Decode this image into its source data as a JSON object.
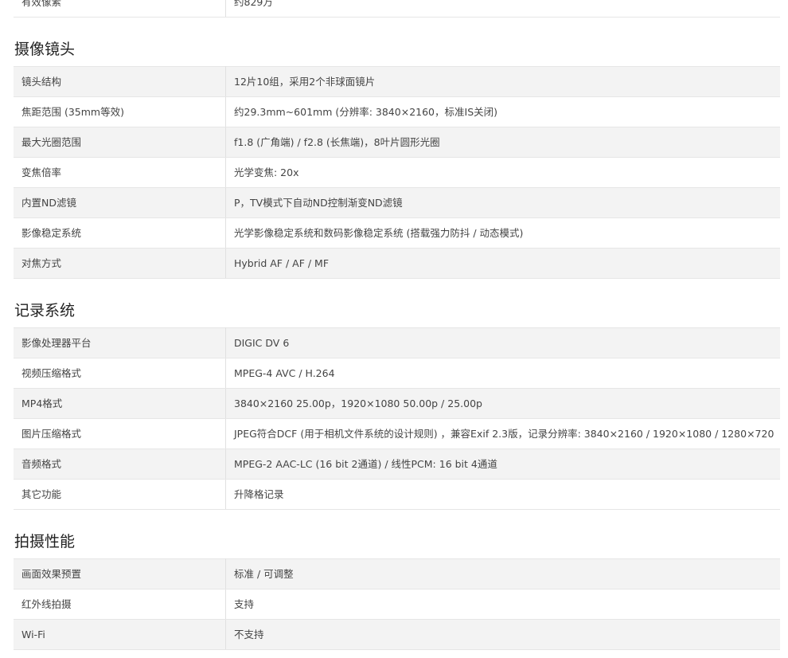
{
  "top_row": {
    "label": "有效像素",
    "value": "约829万"
  },
  "sections": [
    {
      "title": "摄像镜头",
      "rows": [
        {
          "label": "镜头结构",
          "value": "12片10组，采用2个非球面镜片"
        },
        {
          "label": "焦距范围 (35mm等效)",
          "value": "约29.3mm~601mm (分辨率: 3840×2160，标准IS关闭)"
        },
        {
          "label": "最大光圈范围",
          "value": "f1.8 (广角端) / f2.8 (长焦端)，8叶片圆形光圈"
        },
        {
          "label": "变焦倍率",
          "value": "光学变焦: 20x"
        },
        {
          "label": "内置ND滤镜",
          "value": "P，TV模式下自动ND控制渐变ND滤镜"
        },
        {
          "label": "影像稳定系统",
          "value": "光学影像稳定系统和数码影像稳定系统 (搭载强力防抖 / 动态模式)"
        },
        {
          "label": "对焦方式",
          "value": "Hybrid AF / AF / MF"
        }
      ]
    },
    {
      "title": "记录系统",
      "rows": [
        {
          "label": "影像处理器平台",
          "value": "DIGIC DV 6"
        },
        {
          "label": "视频压缩格式",
          "value": "MPEG-4 AVC / H.264"
        },
        {
          "label": "MP4格式",
          "value": "3840×2160 25.00p，1920×1080 50.00p / 25.00p"
        },
        {
          "label": "图片压缩格式",
          "value": "JPEG符合DCF (用于相机文件系统的设计规则) ，兼容Exif 2.3版，记录分辨率: 3840×2160 / 1920×1080 / 1280×720"
        },
        {
          "label": "音频格式",
          "value": "MPEG-2 AAC-LC (16 bit 2通道) / 线性PCM: 16 bit 4通道"
        },
        {
          "label": "其它功能",
          "value": "升降格记录"
        }
      ]
    },
    {
      "title": "拍摄性能",
      "rows": [
        {
          "label": "画面效果预置",
          "value": "标准 / 可调整"
        },
        {
          "label": "红外线拍摄",
          "value": "支持"
        },
        {
          "label": "Wi-Fi",
          "value": "不支持"
        }
      ]
    }
  ]
}
